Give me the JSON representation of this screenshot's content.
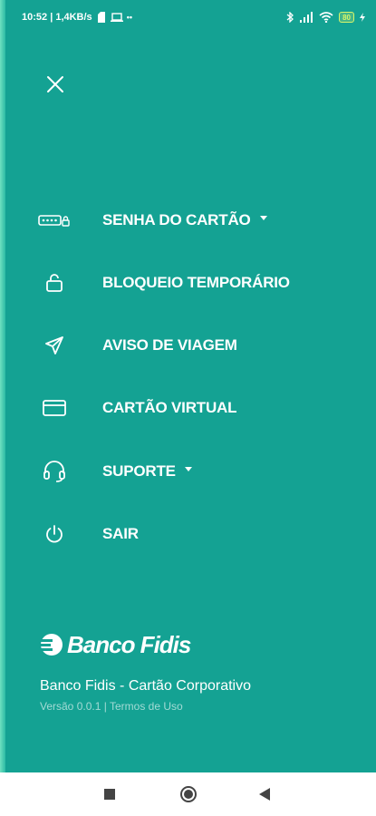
{
  "status_bar": {
    "time_speed": "10:52 | 1,4KB/s",
    "battery": "80"
  },
  "menu": {
    "items": [
      {
        "label": "SENHA DO CARTÃO",
        "icon": "password-icon",
        "has_caret": true
      },
      {
        "label": "BLOQUEIO TEMPORÁRIO",
        "icon": "unlock-icon",
        "has_caret": false
      },
      {
        "label": "AVISO DE VIAGEM",
        "icon": "send-icon",
        "has_caret": false
      },
      {
        "label": "CARTÃO VIRTUAL",
        "icon": "credit-card-icon",
        "has_caret": false
      },
      {
        "label": "SUPORTE",
        "icon": "headset-icon",
        "has_caret": true
      },
      {
        "label": "SAIR",
        "icon": "power-icon",
        "has_caret": false
      }
    ]
  },
  "brand": {
    "name": "Banco Fidis"
  },
  "footer": {
    "title": "Banco Fidis - Cartão Corporativo",
    "version": "Versão 0.0.1",
    "separator": "|",
    "terms": "Termos de Uso"
  },
  "colors": {
    "background": "#14a293",
    "text": "#ffffff",
    "nav_bar": "#ffffff"
  }
}
